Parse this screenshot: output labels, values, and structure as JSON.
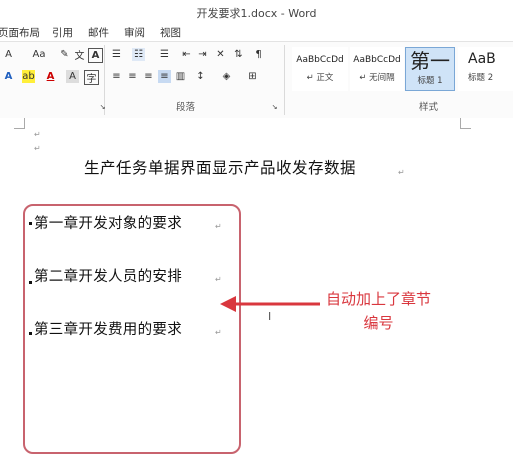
{
  "window": {
    "title": "开发要求1.docx - Word"
  },
  "tabs": [
    "页面布局",
    "引用",
    "邮件",
    "审阅",
    "视图"
  ],
  "ribbon": {
    "font_size_label": "Aa",
    "paragraph_group_label": "段落",
    "styles_group_label": "样式",
    "styles": [
      {
        "sample": "AaBbCcDd",
        "name": "↵ 正文"
      },
      {
        "sample": "AaBbCcDd",
        "name": "↵ 无间隔"
      },
      {
        "sample": "第一",
        "name": "标题 1"
      },
      {
        "sample": "AaB",
        "name": "标题 2"
      }
    ]
  },
  "document": {
    "title": "生产任务单据界面显示产品收发存数据",
    "chapters": [
      "第一章开发对象的要求",
      "第二章开发人员的安排",
      "第三章开发费用的要求"
    ]
  },
  "annotation": {
    "line1": "自动加上了章节",
    "line2": "编号"
  },
  "colors": {
    "annotation_red": "#d9373e",
    "box_border": "#c8636e",
    "style_selected": "#cfe3f7"
  }
}
